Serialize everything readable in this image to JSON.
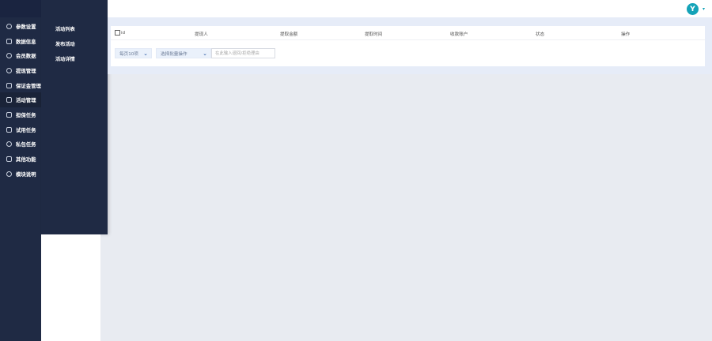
{
  "sidebar": {
    "items": [
      {
        "label": "参数设置",
        "icon": "gear-icon"
      },
      {
        "label": "数据信息",
        "icon": "chart-icon"
      },
      {
        "label": "会员数据",
        "icon": "user-icon"
      },
      {
        "label": "提现管理",
        "icon": "yen-icon"
      },
      {
        "label": "保证金管理",
        "icon": "shield-icon"
      },
      {
        "label": "活动管理",
        "icon": "activity-icon"
      },
      {
        "label": "担保任务",
        "icon": "task-icon"
      },
      {
        "label": "试用任务",
        "icon": "document-icon"
      },
      {
        "label": "私包任务",
        "icon": "package-icon"
      },
      {
        "label": "其他功能",
        "icon": "list-icon"
      },
      {
        "label": "模块说明",
        "icon": "info-icon"
      }
    ],
    "active_index": 5
  },
  "submenu": {
    "items": [
      "活动列表",
      "发布活动",
      "活动详情"
    ]
  },
  "table": {
    "columns": [
      "id",
      "提现人",
      "提取金额",
      "提取时间",
      "收款账户",
      "状态",
      "操作"
    ]
  },
  "toolbar": {
    "page_size": "每页10项",
    "batch_action": "选择批量操作",
    "search_placeholder": "在此输入退回/拒绝理由"
  },
  "colors": {
    "sidebar_bg": "#1f2a44",
    "band_bg": "#e6ecf8",
    "avatar": "#14a3b8"
  }
}
